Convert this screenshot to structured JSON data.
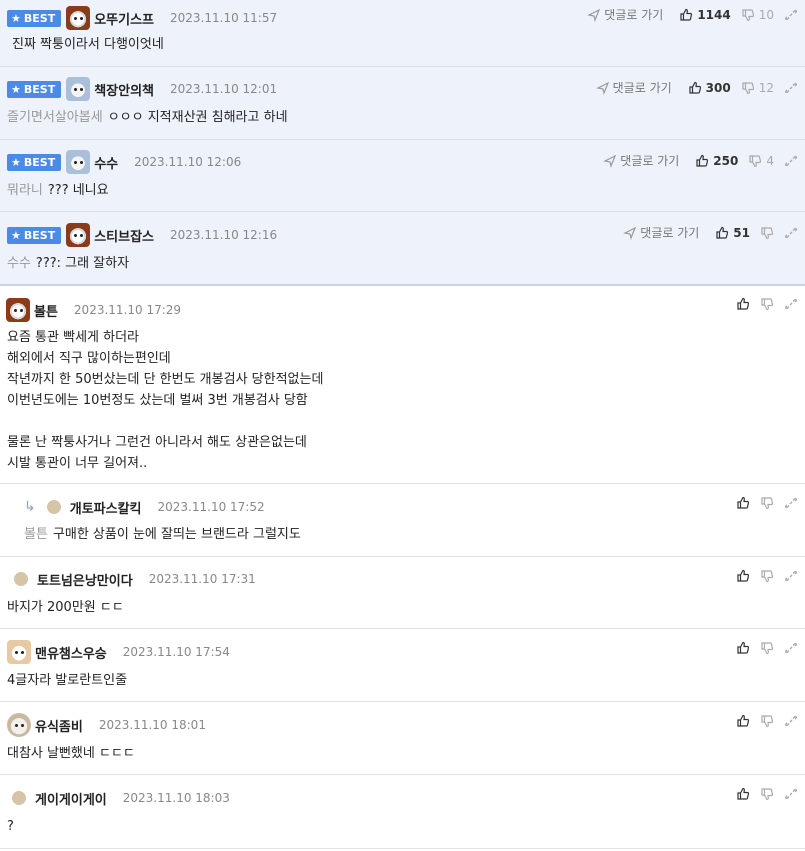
{
  "comments": [
    {
      "best": true,
      "badge": "BEST",
      "nick": "오뚜기스프",
      "date": "2023.11.10 11:57",
      "mention": "",
      "text": "진짜 짝퉁이라서 다행이엇네",
      "goto": "댓글로 가기",
      "likes": "1144",
      "dislikes": "10",
      "avatar": "dog"
    },
    {
      "best": true,
      "badge": "BEST",
      "nick": "책장안의책",
      "date": "2023.11.10 12:01",
      "mention": "즐기면서살아봅세",
      "text": "ㅇㅇㅇ 지적재산권 침해라고 하네",
      "goto": "댓글로 가기",
      "likes": "300",
      "dislikes": "12",
      "avatar": "mask"
    },
    {
      "best": true,
      "badge": "BEST",
      "nick": "수수",
      "date": "2023.11.10 12:06",
      "mention": "뭐라니",
      "text": "??? 네니요",
      "goto": "댓글로 가기",
      "likes": "250",
      "dislikes": "4",
      "avatar": "mask"
    },
    {
      "best": true,
      "badge": "BEST",
      "nick": "스티브잡스",
      "date": "2023.11.10 12:16",
      "mention": "수수",
      "text": "???: 그래 잘하자",
      "goto": "댓글로 가기",
      "likes": "51",
      "dislikes": "",
      "avatar": "dog"
    }
  ],
  "normal": [
    {
      "nick": "볼튼",
      "date": "2023.11.10 17:29",
      "lines": [
        "요즘 통관 빡세게 하더라",
        "해외에서 직구 많이하는편인데",
        "작년까지 한 50번샀는데 단 한번도 개봉검사 당한적없는데",
        "이번년도에는 10번정도 샀는데 벌써 3번 개봉검사 당함",
        "",
        "물론 난 짝퉁사거나 그런건 아니라서 해도 상관은없는데",
        "시발 통관이 너무 길어져.."
      ],
      "avatar": "dog"
    },
    {
      "reply": true,
      "nick": "개토파스칼킥",
      "date": "2023.11.10 17:52",
      "mention": "볼튼",
      "text": "구매한 상품이 눈에 잘띄는 브랜드라 그럴지도",
      "avatar": "blob"
    },
    {
      "nick": "토트넘은낭만이다",
      "date": "2023.11.10 17:31",
      "text": "바지가 200만원 ㄷㄷ",
      "avatar": "blob"
    },
    {
      "nick": "맨유챔스우승",
      "date": "2023.11.10 17:54",
      "text": "4글자라 발로란트인줄",
      "avatar": "cat"
    },
    {
      "nick": "유식좀비",
      "date": "2023.11.10 18:01",
      "text": "대참사 날뻔했네 ㄷㄷㄷ",
      "avatar": "pup"
    },
    {
      "nick": "게이게이게이",
      "date": "2023.11.10 18:03",
      "text": "?",
      "avatar": "blob"
    }
  ]
}
